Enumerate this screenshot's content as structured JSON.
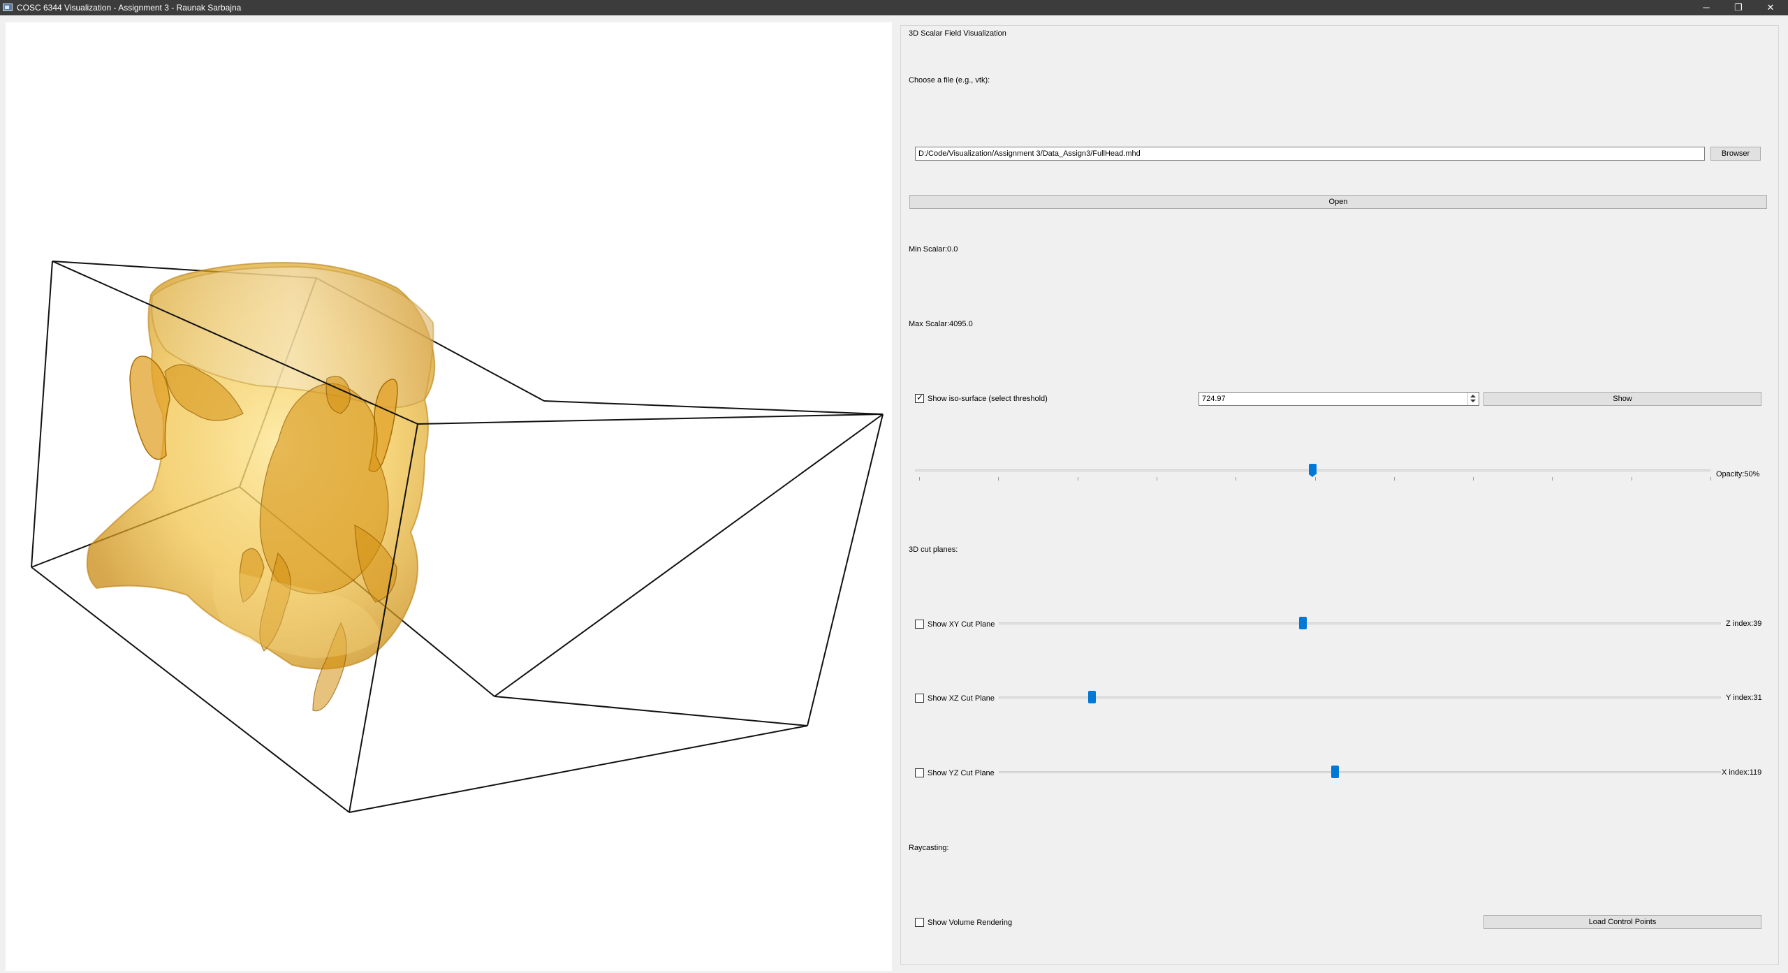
{
  "window": {
    "title": "COSC 6344 Visualization - Assignment 3 - Raunak Sarbajna",
    "min_glyph": "─",
    "max_glyph": "❐",
    "close_glyph": "✕"
  },
  "panel": {
    "title": "3D Scalar Field Visualization",
    "file_label": "Choose a file (e.g., vtk):",
    "file_path": "D:/Code/Visualization/Assignment 3/Data_Assign3/FullHead.mhd",
    "browser_label": "Browser",
    "open_label": "Open",
    "min_scalar": "Min Scalar:0.0",
    "max_scalar": "Max Scalar:4095.0",
    "iso_label": "Show iso-surface (select threshold)",
    "iso_checked": true,
    "iso_value": "724.97",
    "show_label": "Show",
    "opacity_label": "Opacity:50%",
    "opacity_fraction": 0.5,
    "cut_planes_title": "3D cut planes:",
    "xy": {
      "label": "Show XY Cut Plane",
      "index_label": "Z index:39",
      "fraction": 0.42
    },
    "xz": {
      "label": "Show XZ Cut Plane",
      "index_label": "Y index:31",
      "fraction": 0.125
    },
    "yz": {
      "label": "Show YZ Cut Plane",
      "index_label": "X index:119",
      "fraction": 0.465
    },
    "raycasting_title": "Raycasting:",
    "volume_label": "Show Volume Rendering",
    "load_label": "Load Control Points"
  },
  "colors": {
    "slider_handle": "#0078d7",
    "iso_surface": "#e3a420",
    "titlebar": "#3c3c3c"
  }
}
